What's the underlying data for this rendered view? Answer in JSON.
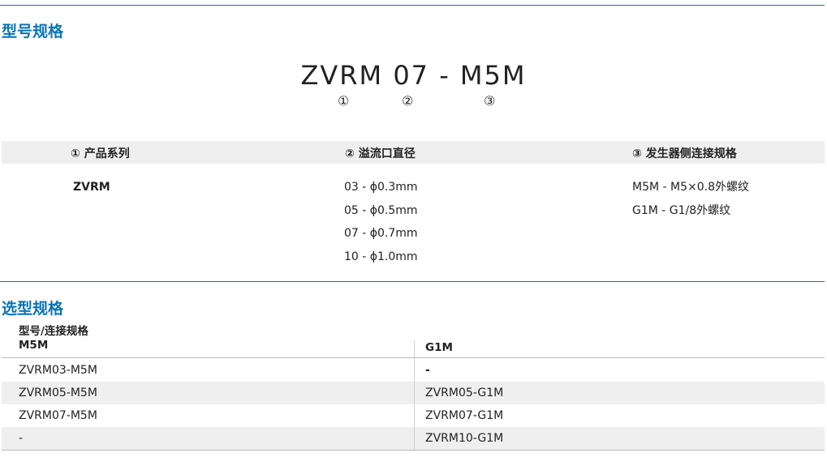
{
  "section1": {
    "title": "型号规格"
  },
  "model": {
    "code": "ZVRM 07 - M5M",
    "markers": [
      "①",
      "②",
      "③"
    ]
  },
  "spec_table": {
    "headers": [
      "① 产品系列",
      "② 溢流口直径",
      "③ 发生器侧连接规格"
    ],
    "series": [
      "ZVRM"
    ],
    "diameters": [
      "03 - ϕ0.3mm",
      "05 - ϕ0.5mm",
      "07 - ϕ0.7mm",
      "10 - ϕ1.0mm"
    ],
    "connections": [
      "M5M - M5×0.8外螺纹",
      "G1M - G1/8外螺纹"
    ]
  },
  "section2": {
    "title": "选型规格"
  },
  "selection_table": {
    "header_caption": "型号/连接规格",
    "columns": [
      "M5M",
      "G1M"
    ],
    "rows": [
      [
        "ZVRM03-M5M",
        "-"
      ],
      [
        "ZVRM05-M5M",
        "ZVRM05-G1M"
      ],
      [
        "ZVRM07-M5M",
        "ZVRM07-G1M"
      ],
      [
        "-",
        "ZVRM10-G1M"
      ]
    ]
  }
}
